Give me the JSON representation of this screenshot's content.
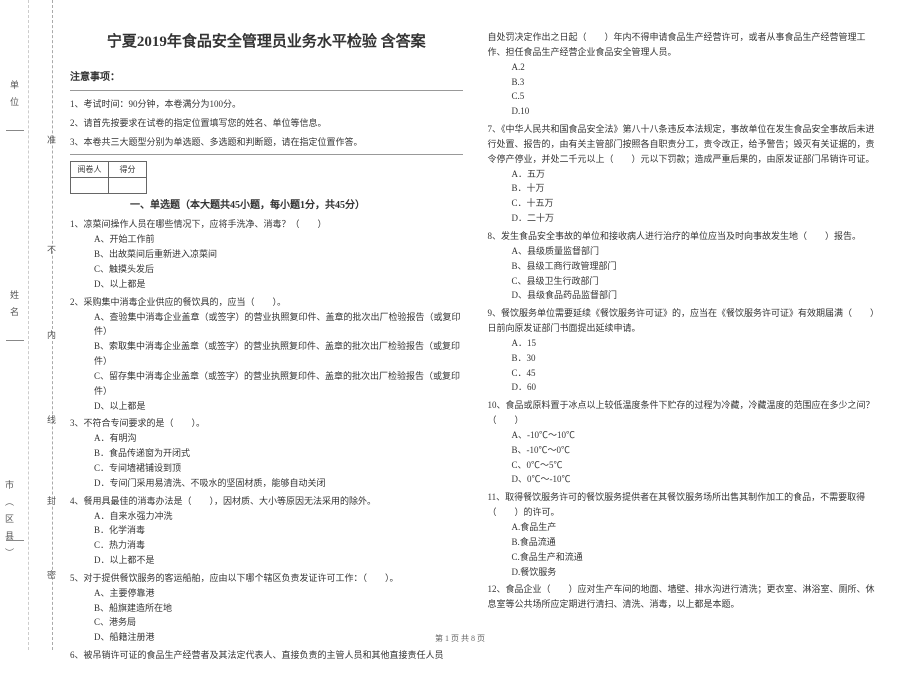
{
  "binding": {
    "unit": "单位",
    "zhun": "准",
    "bu": "不",
    "name": "姓名",
    "nei": "内",
    "xian": "线",
    "feng": "封",
    "city": "市（区县）",
    "mi": "密"
  },
  "title": "宁夏2019年食品安全管理员业务水平检验 含答案",
  "notice_label": "注意事项：",
  "notices": {
    "n1": "1、考试时间：90分钟，本卷满分为100分。",
    "n2": "2、请首先按要求在试卷的指定位置填写您的姓名、单位等信息。",
    "n3": "3、本卷共三大题型分别为单选题、多选题和判断题，请在指定位置作答。"
  },
  "score_table": {
    "examiner": "阅卷人",
    "score": "得分"
  },
  "section1": "一、单选题（本大题共45小题，每小题1分，共45分）",
  "q1": {
    "stem": "1、凉菜间操作人员在哪些情况下，应将手洗净、消毒？（　　）",
    "a": "A、开始工作前",
    "b": "B、出故菜间后重新进入凉菜间",
    "c": "C、触摸头发后",
    "d": "D、以上都是"
  },
  "q2": {
    "stem": "2、采购集中消毒企业供应的餐饮具的，应当（　　）。",
    "a": "A、查验集中消毒企业盖章（或签字）的营业执照复印件、盖章的批次出厂检验报告（或复印件）",
    "b": "B、索取集中消毒企业盖章（或签字）的营业执照复印件、盖章的批次出厂检验报告（或复印件）",
    "c": "C、留存集中消毒企业盖章（或签字）的营业执照复印件、盖章的批次出厂检验报告（或复印件）",
    "d": "D、以上都是"
  },
  "q3": {
    "stem": "3、不符合专间要求的是（　　）。",
    "a": "A．有明沟",
    "b": "B．食品传递窗为开闭式",
    "c": "C．专间墙裙铺设到顶",
    "d": "D．专间门采用易清洗、不吸水的坚固材质，能够自动关闭"
  },
  "q4": {
    "stem": "4、餐用具最佳的消毒办法是（　　），因材质、大小等原因无法采用的除外。",
    "a": "A．自来水强力冲洗",
    "b": "B．化学消毒",
    "c": "C．热力消毒",
    "d": "D．以上都不是"
  },
  "q5": {
    "stem": "5、对于提供餐饮服务的客运船舶，应由以下哪个辖区负责发证许可工作：（　　）。",
    "a": "A、主要停靠港",
    "b": "B、船旗建造所在地",
    "c": "C、港务局",
    "d": "D、船籍注册港"
  },
  "q6": {
    "stem": "6、被吊销许可证的食品生产经营者及其法定代表人、直接负责的主管人员和其他直接责任人员"
  },
  "q6cont": "自处罚决定作出之日起（　　）年内不得申请食品生产经营许可，或者从事食品生产经营管理工作、担任食品生产经营企业食品安全管理人员。",
  "q6opts": {
    "a": "A.2",
    "b": "B.3",
    "c": "C.5",
    "d": "D.10"
  },
  "q7": {
    "stem": "7、《中华人民共和国食品安全法》第八十八条违反本法规定，事故单位在发生食品安全事故后未进行处置、报告的，由有关主管部门按照各自职责分工，责令改正，给予警告；毁灭有关证据的，责令停产停业，并处二千元以上（　　）元以下罚款；造成严重后果的，由原发证部门吊销许可证。",
    "a": "A．五万",
    "b": "B．十万",
    "c": "C．十五万",
    "d": "D．二十万"
  },
  "q8": {
    "stem": "8、发生食品安全事故的单位和接收病人进行治疗的单位应当及时向事故发生地（　　）报告。",
    "a": "A、县级质量监督部门",
    "b": "B、县级工商行政管理部门",
    "c": "C、县级卫生行政部门",
    "d": "D、县级食品药品监督部门"
  },
  "q9": {
    "stem": "9、餐饮服务单位需要延续《餐饮服务许可证》的，应当在《餐饮服务许可证》有效期届满（　　）日前向原发证部门书面提出延续申请。",
    "a": "A．15",
    "b": "B．30",
    "c": "C．45",
    "d": "D．60"
  },
  "q10": {
    "stem": "10、食品或原料置于冰点以上较低温度条件下贮存的过程为冷藏，冷藏温度的范围应在多少之间？（　　）",
    "a": "A、-10℃～10℃",
    "b": "B、-10℃～0℃",
    "c": "C、0℃～5℃",
    "d": "D、0℃～-10℃"
  },
  "q11": {
    "stem": "11、取得餐饮服务许可的餐饮服务提供者在其餐饮服务场所出售其制作加工的食品，不需要取得（　　）的许可。",
    "a": "A.食品生产",
    "b": "B.食品流通",
    "c": "C.食品生产和流通",
    "d": "D.餐饮服务"
  },
  "q12": {
    "stem": "12、食品企业（　　）应对生产车间的地面、墙壁、排水沟进行清洗；更衣室、淋浴室、厕所、休息室等公共场所应定期进行清扫、清洗、消毒，以上都是本题。"
  },
  "footer": "第 1 页 共 8 页"
}
